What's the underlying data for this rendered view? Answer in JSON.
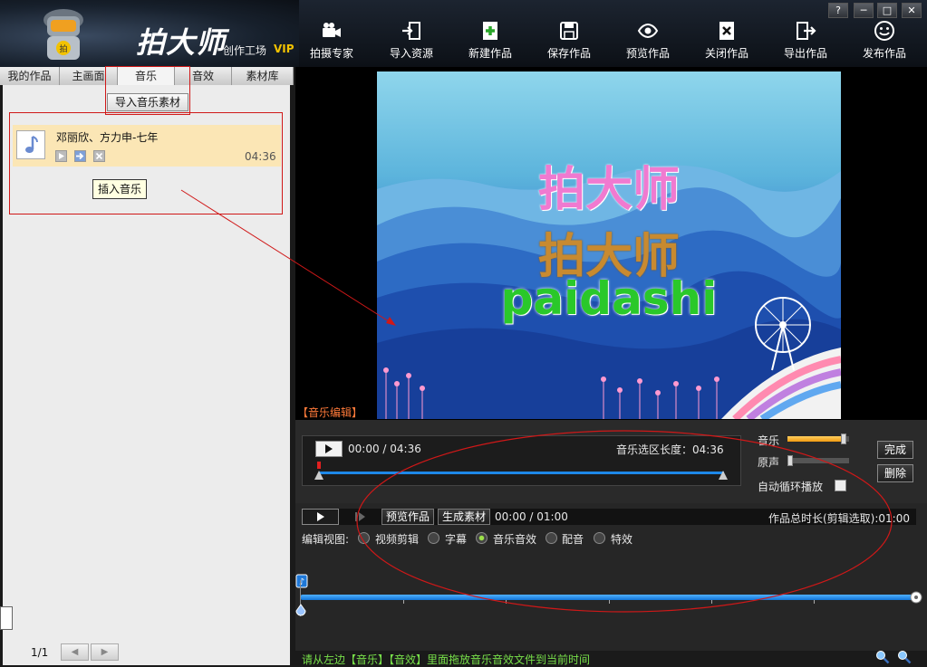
{
  "app": {
    "logo_text": "拍大师",
    "logo_sub": "创作工场",
    "logo_vip": "VIP",
    "window_buttons": [
      "?",
      "─",
      "□",
      "✕"
    ]
  },
  "toolbar": {
    "items": [
      {
        "label": "拍摄专家",
        "icon": "video-camera-icon"
      },
      {
        "label": "导入资源",
        "icon": "import-icon"
      },
      {
        "label": "新建作品",
        "icon": "new-file-icon"
      },
      {
        "label": "保存作品",
        "icon": "save-icon"
      },
      {
        "label": "预览作品",
        "icon": "eye-icon"
      },
      {
        "label": "关闭作品",
        "icon": "close-file-icon"
      },
      {
        "label": "导出作品",
        "icon": "export-icon"
      },
      {
        "label": "发布作品",
        "icon": "smiley-icon"
      }
    ]
  },
  "tabs": [
    {
      "label": "我的作品"
    },
    {
      "label": "主画面"
    },
    {
      "label": "音乐"
    },
    {
      "label": "音效"
    },
    {
      "label": "素材库"
    }
  ],
  "left_panel": {
    "import_button": "导入音乐素材",
    "music_item": {
      "title": "邓丽欣、方力申-七年",
      "duration": "04:36"
    },
    "insert_tooltip": "插入音乐",
    "page_indicator": "1/1",
    "prev_label": "◀",
    "next_label": "▶"
  },
  "preview": {
    "title_line1": "拍大师",
    "title_line2": "拍大师",
    "title_line3": "paidashi",
    "section_label": "【音乐编辑】"
  },
  "music_edit": {
    "time_display": "00:00 / 04:36",
    "selection_length": "音乐选区长度：04:36",
    "music_label": "音乐",
    "original_label": "原声",
    "music_volume": 0.95,
    "original_volume": 0.0,
    "auto_loop_label": "自动循环播放",
    "auto_loop_checked": false,
    "done_button": "完成",
    "delete_button": "删除"
  },
  "timeline": {
    "preview_button": "预览作品",
    "generate_button": "生成素材",
    "time_display": "00:00 / 01:00",
    "total_duration": "作品总时长(剪辑选取):01:00",
    "view_label": "编辑视图:",
    "views": [
      {
        "label": "视频剪辑",
        "selected": false
      },
      {
        "label": "字幕",
        "selected": false
      },
      {
        "label": "音乐音效",
        "selected": true
      },
      {
        "label": "配音",
        "selected": false
      },
      {
        "label": "特效",
        "selected": false
      }
    ]
  },
  "status": {
    "hint": "请从左边【音乐】【音效】里面拖放音乐音效文件到当前时间"
  },
  "colors": {
    "accent_orange": "#ff7a3a",
    "status_green": "#78e04a",
    "track_blue": "#1e88e8",
    "annotation_red": "#d01818"
  }
}
